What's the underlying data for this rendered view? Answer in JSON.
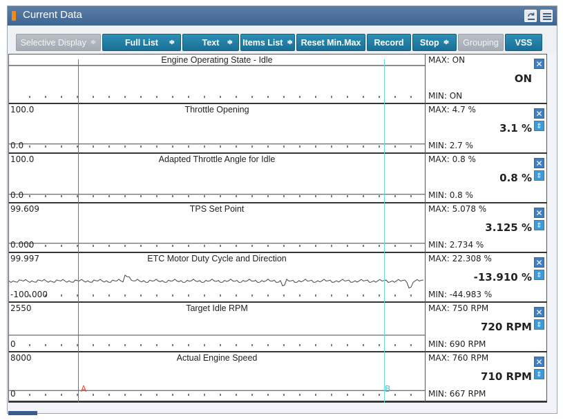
{
  "window": {
    "title": "Current Data",
    "refresh_label": "Refresh",
    "icons": {
      "refresh": "refresh-icon",
      "menu": "menu-icon"
    }
  },
  "toolbar": {
    "selective_display": "Selective Display",
    "full_list": "Full List",
    "text": "Text",
    "items_list": "Items List",
    "reset_minmax": "Reset Min.Max",
    "record": "Record",
    "stop": "Stop",
    "grouping": "Grouping",
    "vss": "VSS",
    "spin_glyph": "≑"
  },
  "cursors": {
    "a_label": "A",
    "b_label": "B"
  },
  "colors": {
    "accent": "#1a6f95",
    "cursor_a": "#ee4422",
    "cursor_b": "#66dddd",
    "close_button": "#3f7fc0"
  },
  "rows": [
    {
      "name": "Engine Operating State - Idle",
      "scale_max": "",
      "scale_min": "",
      "max": "MAX: ON",
      "current": "ON",
      "min": "MIN: ON",
      "has_updown": false
    },
    {
      "name": "Throttle Opening",
      "scale_max": "100.0",
      "scale_min": "0.0",
      "max": "MAX:   4.7 %",
      "current": "3.1 %",
      "min": "MIN:   2.7 %",
      "has_updown": true
    },
    {
      "name": "Adapted Throttle Angle for Idle",
      "scale_max": "100.0",
      "scale_min": "0.0",
      "max": "MAX:   0.8 %",
      "current": "0.8 %",
      "min": "MIN:   0.8 %",
      "has_updown": true
    },
    {
      "name": "TPS Set Point",
      "scale_max": "99.609",
      "scale_min": "0.000",
      "max": "MAX: 5.078 %",
      "current": "3.125 %",
      "min": "MIN: 2.734 %",
      "has_updown": true
    },
    {
      "name": "ETC Motor Duty Cycle and Direction",
      "scale_max": "99.997",
      "scale_min": "-100.000",
      "max": "MAX: 22.308 %",
      "current": "-13.910 %",
      "min": "MIN: -44.983 %",
      "has_updown": true
    },
    {
      "name": "Target Idle RPM",
      "scale_max": "2550",
      "scale_min": "0",
      "max": "MAX:   750 RPM",
      "current": "720 RPM",
      "min": "MIN:   690 RPM",
      "has_updown": true
    },
    {
      "name": "Actual Engine Speed",
      "scale_max": "8000",
      "scale_min": "0",
      "max": "MAX:   760 RPM",
      "current": "710 RPM",
      "min": "MIN:   667 RPM",
      "has_updown": true
    }
  ],
  "traces": [
    {
      "kind": "flat",
      "level": 1.0
    },
    {
      "kind": "flat",
      "level": 0.031
    },
    {
      "kind": "flat",
      "level": 0.008
    },
    {
      "kind": "flat",
      "level": 0.031
    },
    {
      "kind": "noise",
      "level": -0.139
    },
    {
      "kind": "flat",
      "level": 0.28
    },
    {
      "kind": "flat",
      "level": 0.089
    }
  ]
}
